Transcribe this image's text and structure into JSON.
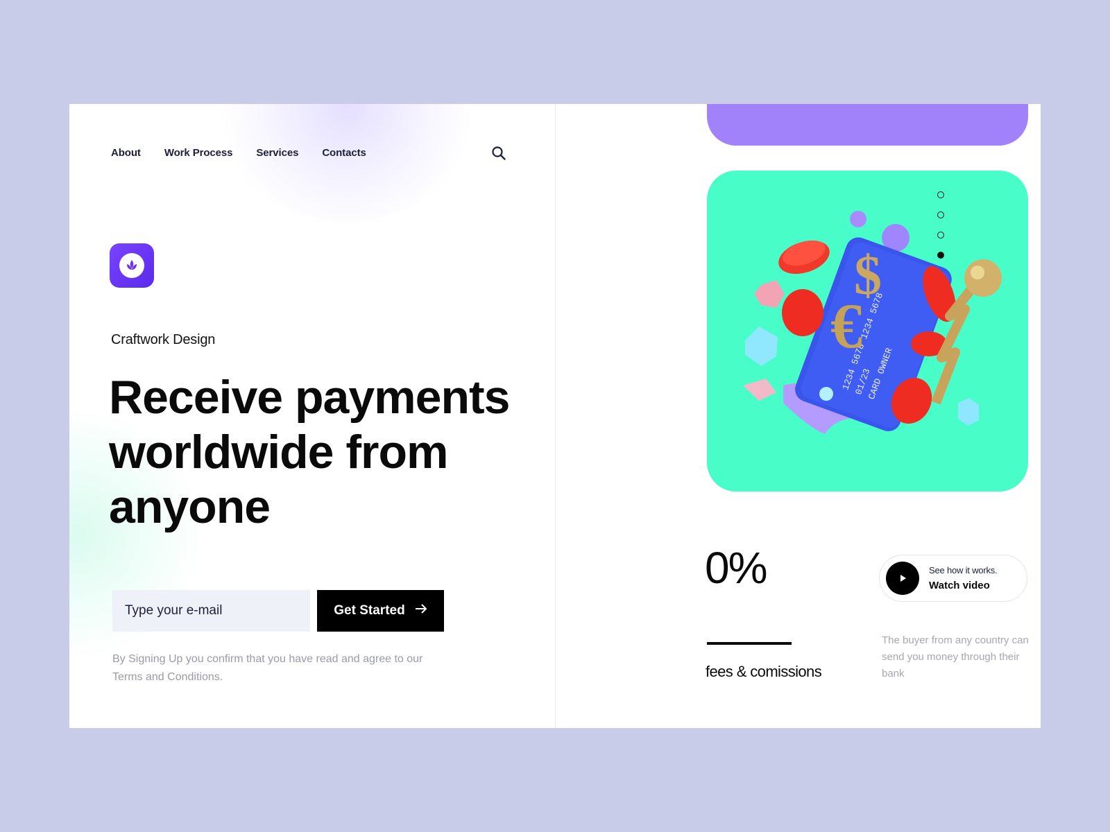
{
  "nav": {
    "items": [
      {
        "label": "About"
      },
      {
        "label": "Work Process"
      },
      {
        "label": "Services"
      },
      {
        "label": "Contacts"
      }
    ],
    "search_icon": "search-icon"
  },
  "brand": {
    "logo_icon": "leaf-icon",
    "name": "Craftwork Design"
  },
  "hero": {
    "headline": "Receive payments worldwide from anyone"
  },
  "signup": {
    "email_placeholder": "Type your e-mail",
    "button_label": "Get Started",
    "button_icon": "arrow-right-icon",
    "disclaimer": "By Signing Up you confirm that you have read and agree to our Terms and Conditions."
  },
  "stats": {
    "value": "0%",
    "label": "fees & comissions"
  },
  "video": {
    "caption": "See how it works.",
    "label": "Watch video",
    "icon": "play-icon"
  },
  "description": "The buyer from any country can send you money through their bank",
  "illustration": {
    "card_number_1": "1234 5678 1234 5678",
    "card_expiry": "01/23",
    "card_owner": "CARD OWNER"
  },
  "pagination": {
    "total": 4,
    "active_index": 3
  },
  "colors": {
    "background": "#c8cce8",
    "accent_purple": "#a182fb",
    "accent_green": "#49fdc8",
    "logo": "#6a35f5",
    "button": "#000000"
  }
}
